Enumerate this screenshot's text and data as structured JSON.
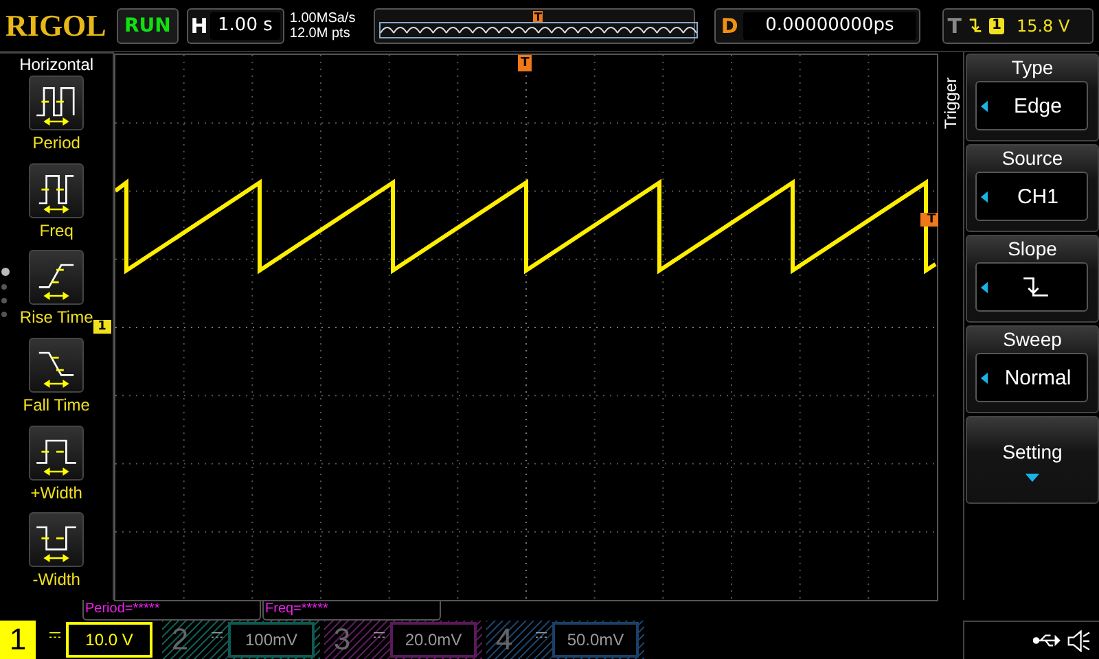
{
  "brand": "RIGOL",
  "run_state": {
    "label": "RUN"
  },
  "timebase": {
    "letter": "H",
    "value": "1.00 s"
  },
  "acquisition": {
    "sample_rate": "1.00MSa/s",
    "depth": "12.0M pts"
  },
  "trigger_position": {
    "marker": "T"
  },
  "delay": {
    "letter": "D",
    "value": "0.00000000ps"
  },
  "trigger_status": {
    "letter": "T",
    "channel": "1",
    "voltage": "15.8 V"
  },
  "left_menu": {
    "title": "Horizontal",
    "items": [
      {
        "label": "Period",
        "kind": "period"
      },
      {
        "label": "Freq",
        "kind": "freq"
      },
      {
        "label": "Rise Time",
        "kind": "rise"
      },
      {
        "label": "Fall Time",
        "kind": "fall"
      },
      {
        "label": "+Width",
        "kind": "pwidth"
      },
      {
        "label": "-Width",
        "kind": "nwidth"
      }
    ],
    "pages": [
      {
        "selected": true
      },
      {
        "selected": false
      },
      {
        "selected": false
      },
      {
        "selected": false
      }
    ]
  },
  "screen": {
    "channel_marker": "1",
    "top_trigger_marker": "T",
    "side_trigger_marker": "T"
  },
  "right_menu": {
    "title": "Trigger",
    "items": [
      {
        "label": "Type",
        "kind": "value",
        "value": "Edge"
      },
      {
        "label": "Source",
        "kind": "value",
        "value": "CH1"
      },
      {
        "label": "Slope",
        "kind": "slope"
      },
      {
        "label": "Sweep",
        "kind": "value",
        "value": "Normal"
      },
      {
        "label": "Setting",
        "kind": "submenu"
      }
    ]
  },
  "measurements": [
    "Period=*****",
    "Freq=*****"
  ],
  "channels": [
    {
      "number": "1",
      "scale": "10.0 V",
      "on": true,
      "color": "#ffff00"
    },
    {
      "number": "2",
      "scale": "100mV",
      "on": false,
      "color": "#0e5a52"
    },
    {
      "number": "3",
      "scale": "20.0mV",
      "on": false,
      "color": "#5a1a5a"
    },
    {
      "number": "4",
      "scale": "50.0mV",
      "on": false,
      "color": "#1a4068"
    }
  ]
}
